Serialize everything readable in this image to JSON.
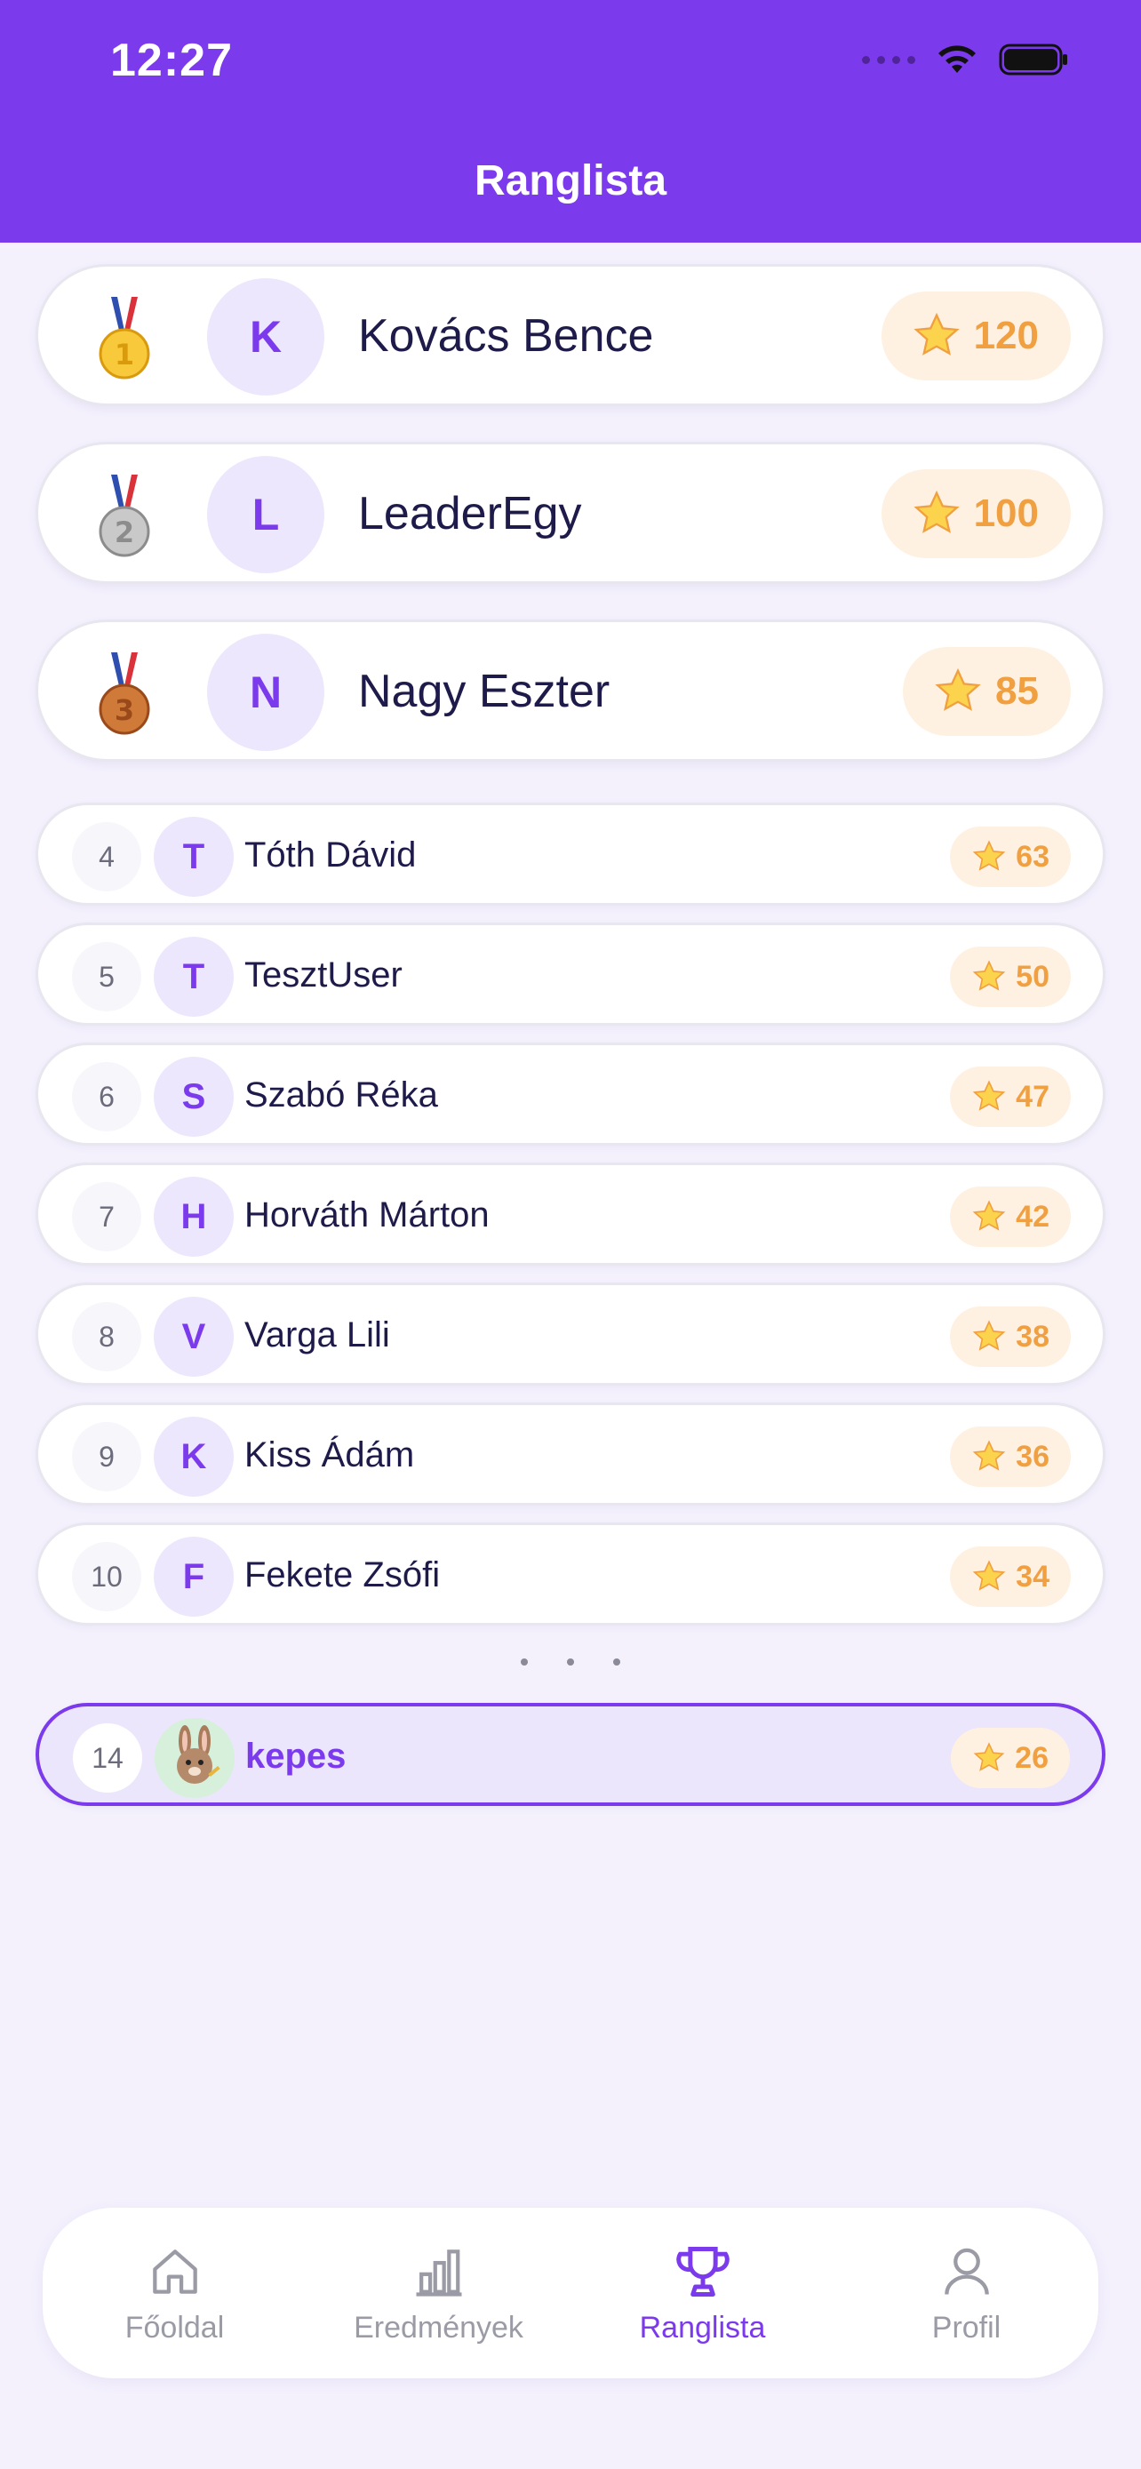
{
  "status_bar": {
    "time": "12:27"
  },
  "header": {
    "title": "Ranglista"
  },
  "colors": {
    "accent": "#7c3aed",
    "score_bg": "#fff1e2",
    "score_text": "#f0a040",
    "background": "#f4f1fd"
  },
  "podium": [
    {
      "rank": "1",
      "medal": "gold-medal-icon",
      "initial": "K",
      "name": "Kovács Bence",
      "score": "120"
    },
    {
      "rank": "2",
      "medal": "silver-medal-icon",
      "initial": "L",
      "name": "LeaderEgy",
      "score": "100"
    },
    {
      "rank": "3",
      "medal": "bronze-medal-icon",
      "initial": "N",
      "name": "Nagy Eszter",
      "score": "85"
    }
  ],
  "rows": [
    {
      "rank": "4",
      "initial": "T",
      "name": "Tóth Dávid",
      "score": "63"
    },
    {
      "rank": "5",
      "initial": "T",
      "name": "TesztUser",
      "score": "50"
    },
    {
      "rank": "6",
      "initial": "S",
      "name": "Szabó Réka",
      "score": "47"
    },
    {
      "rank": "7",
      "initial": "H",
      "name": "Horváth Márton",
      "score": "42"
    },
    {
      "rank": "8",
      "initial": "V",
      "name": "Varga Lili",
      "score": "38"
    },
    {
      "rank": "9",
      "initial": "K",
      "name": "Kiss Ádám",
      "score": "36"
    },
    {
      "rank": "10",
      "initial": "F",
      "name": "Fekete Zsófi",
      "score": "34"
    }
  ],
  "current_user": {
    "rank": "14",
    "avatar": "bunny-avatar-icon",
    "name": "kepes",
    "score": "26"
  },
  "tabbar": {
    "items": [
      {
        "label": "Főoldal",
        "icon": "home-icon"
      },
      {
        "label": "Eredmények",
        "icon": "bar-chart-icon"
      },
      {
        "label": "Ranglista",
        "icon": "trophy-icon",
        "active": true
      },
      {
        "label": "Profil",
        "icon": "person-icon"
      }
    ]
  }
}
